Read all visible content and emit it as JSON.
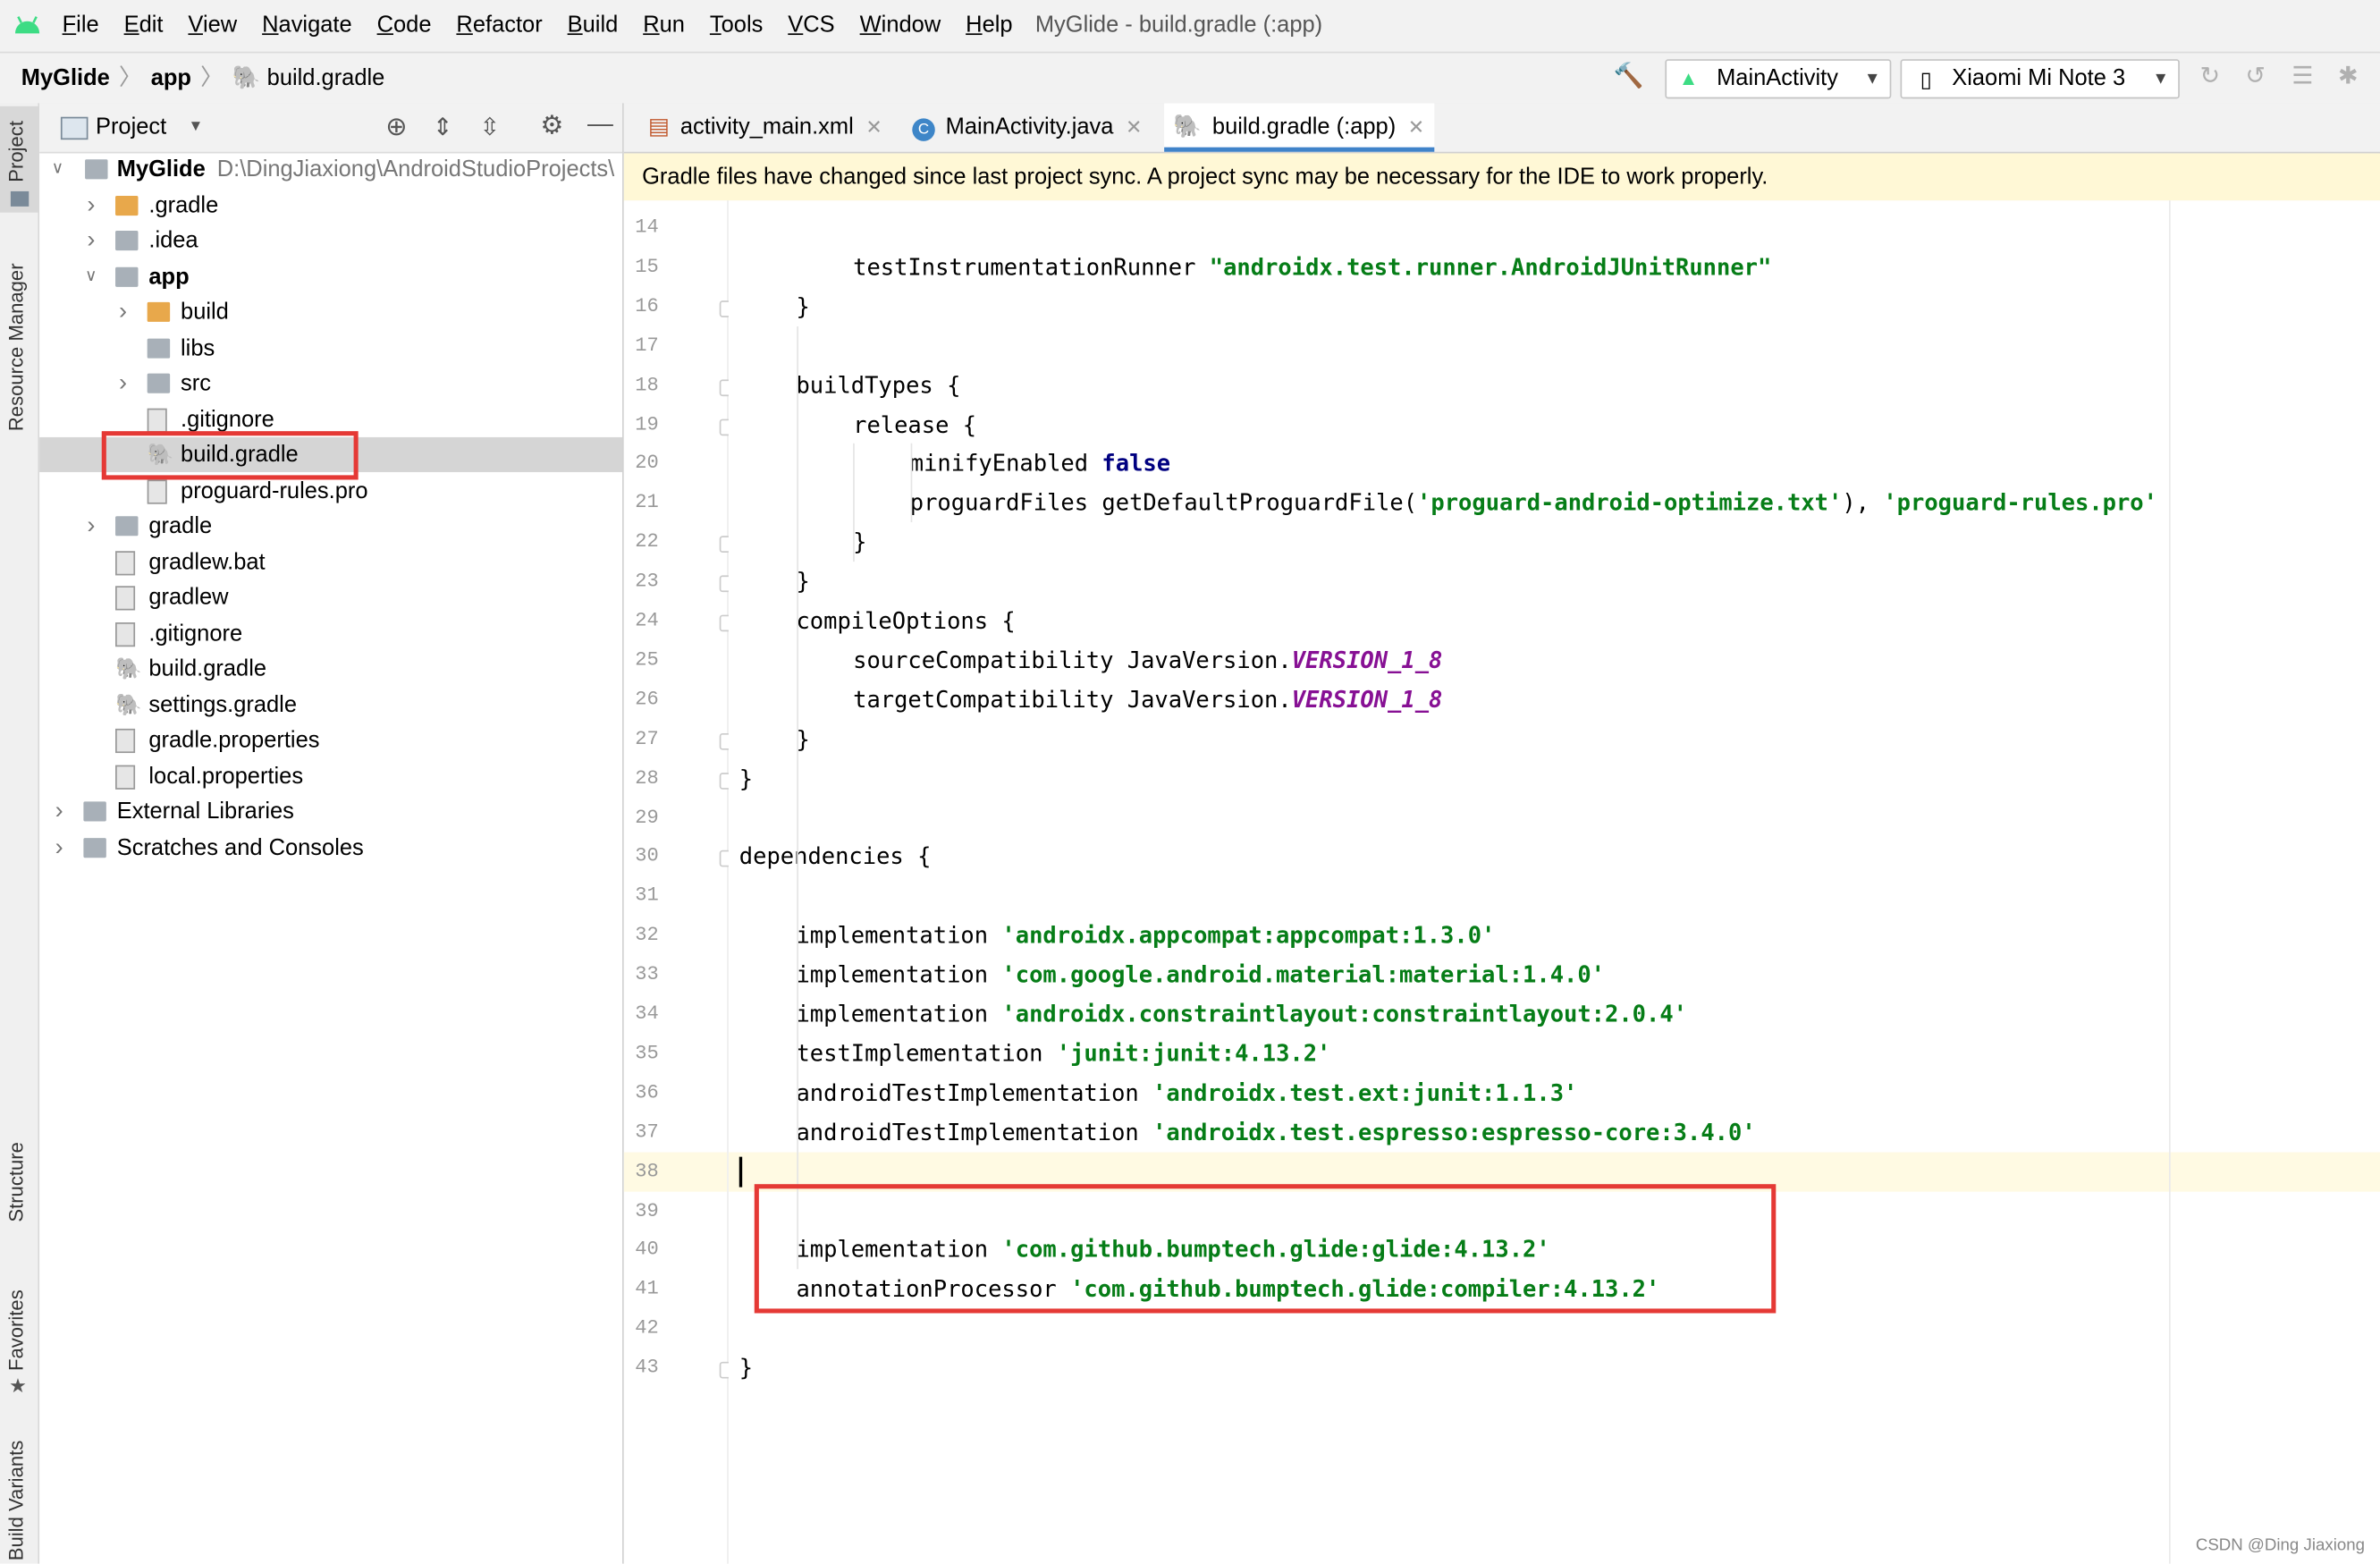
{
  "menubar": {
    "items": [
      "File",
      "Edit",
      "View",
      "Navigate",
      "Code",
      "Refactor",
      "Build",
      "Run",
      "Tools",
      "VCS",
      "Window",
      "Help"
    ],
    "window_title": "MyGlide - build.gradle (:app)"
  },
  "navbar": {
    "breadcrumb": [
      "MyGlide",
      "app",
      "build.gradle"
    ],
    "run_config": "MainActivity",
    "device": "Xiaomi Mi Note 3"
  },
  "left_strip": [
    "Project",
    "Resource Manager",
    "Structure",
    "Favorites",
    "Build Variants"
  ],
  "project_panel": {
    "title": "Project",
    "root_name": "MyGlide",
    "root_path": "D:\\DingJiaxiong\\AndroidStudioProjects\\",
    "tree": [
      {
        "label": ".gradle",
        "icon": "folder-orange-icon",
        "depth": 1,
        "arrow": "right"
      },
      {
        "label": ".idea",
        "icon": "folder-icon",
        "depth": 1,
        "arrow": "right"
      },
      {
        "label": "app",
        "icon": "module-folder-icon",
        "depth": 1,
        "arrow": "down",
        "bold": true
      },
      {
        "label": "build",
        "icon": "folder-orange-icon",
        "depth": 2,
        "arrow": "right"
      },
      {
        "label": "libs",
        "icon": "folder-icon",
        "depth": 2,
        "arrow": ""
      },
      {
        "label": "src",
        "icon": "folder-icon",
        "depth": 2,
        "arrow": "right"
      },
      {
        "label": ".gitignore",
        "icon": "gitignore-file-icon",
        "depth": 2,
        "arrow": ""
      },
      {
        "label": "build.gradle",
        "icon": "gradle-icon",
        "depth": 2,
        "arrow": "",
        "selected": true
      },
      {
        "label": "proguard-rules.pro",
        "icon": "text-file-icon",
        "depth": 2,
        "arrow": ""
      },
      {
        "label": "gradle",
        "icon": "folder-icon",
        "depth": 1,
        "arrow": "right"
      },
      {
        "label": "gradlew.bat",
        "icon": "text-file-icon",
        "depth": 1,
        "arrow": ""
      },
      {
        "label": "gradlew",
        "icon": "script-file-icon",
        "depth": 1,
        "arrow": ""
      },
      {
        "label": ".gitignore",
        "icon": "gitignore-file-icon",
        "depth": 1,
        "arrow": ""
      },
      {
        "label": "build.gradle",
        "icon": "gradle-icon",
        "depth": 1,
        "arrow": ""
      },
      {
        "label": "settings.gradle",
        "icon": "gradle-icon",
        "depth": 1,
        "arrow": ""
      },
      {
        "label": "gradle.properties",
        "icon": "properties-file-icon",
        "depth": 1,
        "arrow": ""
      },
      {
        "label": "local.properties",
        "icon": "properties-file-icon",
        "depth": 1,
        "arrow": ""
      },
      {
        "label": "External Libraries",
        "icon": "libraries-icon",
        "depth": 0,
        "arrow": "right"
      },
      {
        "label": "Scratches and Consoles",
        "icon": "scratches-icon",
        "depth": 0,
        "arrow": "right"
      }
    ]
  },
  "editor": {
    "tabs": [
      {
        "label": "activity_main.xml",
        "icon": "xml-file-icon",
        "active": false
      },
      {
        "label": "MainActivity.java",
        "icon": "java-class-icon",
        "active": false
      },
      {
        "label": "build.gradle (:app)",
        "icon": "gradle-icon",
        "active": true
      }
    ],
    "banner": "Gradle files have changed since last project sync. A project sync may be necessary for the IDE to work properly.",
    "current_line": 38,
    "lines": [
      {
        "n": 14,
        "indent": 0,
        "tokens": []
      },
      {
        "n": 15,
        "indent": 2,
        "tokens": [
          {
            "t": "testInstrumentationRunner ",
            "c": "plain"
          },
          {
            "t": "\"androidx.test.runner.AndroidJUnitRunner\"",
            "c": "str"
          }
        ]
      },
      {
        "n": 16,
        "indent": 1,
        "tokens": [
          {
            "t": "}",
            "c": "plain"
          }
        ]
      },
      {
        "n": 17,
        "indent": 0,
        "tokens": []
      },
      {
        "n": 18,
        "indent": 1,
        "tokens": [
          {
            "t": "buildTypes {",
            "c": "plain"
          }
        ]
      },
      {
        "n": 19,
        "indent": 2,
        "tokens": [
          {
            "t": "release {",
            "c": "plain"
          }
        ]
      },
      {
        "n": 20,
        "indent": 3,
        "tokens": [
          {
            "t": "minifyEnabled ",
            "c": "plain"
          },
          {
            "t": "false",
            "c": "kw"
          }
        ]
      },
      {
        "n": 21,
        "indent": 3,
        "tokens": [
          {
            "t": "proguardFiles getDefaultProguardFile(",
            "c": "plain"
          },
          {
            "t": "'proguard-android-optimize.txt'",
            "c": "str"
          },
          {
            "t": "), ",
            "c": "plain"
          },
          {
            "t": "'proguard-rules.pro'",
            "c": "str"
          }
        ]
      },
      {
        "n": 22,
        "indent": 2,
        "tokens": [
          {
            "t": "}",
            "c": "plain"
          }
        ]
      },
      {
        "n": 23,
        "indent": 1,
        "tokens": [
          {
            "t": "}",
            "c": "plain"
          }
        ]
      },
      {
        "n": 24,
        "indent": 1,
        "tokens": [
          {
            "t": "compileOptions {",
            "c": "plain"
          }
        ]
      },
      {
        "n": 25,
        "indent": 2,
        "tokens": [
          {
            "t": "sourceCompatibility JavaVersion.",
            "c": "plain"
          },
          {
            "t": "VERSION_1_8",
            "c": "const"
          }
        ]
      },
      {
        "n": 26,
        "indent": 2,
        "tokens": [
          {
            "t": "targetCompatibility JavaVersion.",
            "c": "plain"
          },
          {
            "t": "VERSION_1_8",
            "c": "const"
          }
        ]
      },
      {
        "n": 27,
        "indent": 1,
        "tokens": [
          {
            "t": "}",
            "c": "plain"
          }
        ]
      },
      {
        "n": 28,
        "indent": 0,
        "tokens": [
          {
            "t": "}",
            "c": "plain"
          }
        ]
      },
      {
        "n": 29,
        "indent": 0,
        "tokens": []
      },
      {
        "n": 30,
        "indent": 0,
        "tokens": [
          {
            "t": "dependencies {",
            "c": "plain"
          }
        ]
      },
      {
        "n": 31,
        "indent": 0,
        "tokens": []
      },
      {
        "n": 32,
        "indent": 1,
        "tokens": [
          {
            "t": "implementation ",
            "c": "plain"
          },
          {
            "t": "'androidx.appcompat:appcompat:1.3.0'",
            "c": "str"
          }
        ]
      },
      {
        "n": 33,
        "indent": 1,
        "tokens": [
          {
            "t": "implementation ",
            "c": "plain"
          },
          {
            "t": "'com.google.android.material:material:1.4.0'",
            "c": "str"
          }
        ]
      },
      {
        "n": 34,
        "indent": 1,
        "tokens": [
          {
            "t": "implementation ",
            "c": "plain"
          },
          {
            "t": "'androidx.constraintlayout:constraintlayout:2.0.4'",
            "c": "str"
          }
        ]
      },
      {
        "n": 35,
        "indent": 1,
        "tokens": [
          {
            "t": "testImplementation ",
            "c": "plain"
          },
          {
            "t": "'junit:junit:4.13.2'",
            "c": "str"
          }
        ]
      },
      {
        "n": 36,
        "indent": 1,
        "tokens": [
          {
            "t": "androidTestImplementation ",
            "c": "plain"
          },
          {
            "t": "'androidx.test.ext:junit:1.1.3'",
            "c": "str"
          }
        ]
      },
      {
        "n": 37,
        "indent": 1,
        "tokens": [
          {
            "t": "androidTestImplementation ",
            "c": "plain"
          },
          {
            "t": "'androidx.test.espresso:espresso-core:3.4.0'",
            "c": "str"
          }
        ]
      },
      {
        "n": 38,
        "indent": 0,
        "tokens": []
      },
      {
        "n": 39,
        "indent": 0,
        "tokens": []
      },
      {
        "n": 40,
        "indent": 1,
        "tokens": [
          {
            "t": "implementation ",
            "c": "plain"
          },
          {
            "t": "'com.github.bumptech.glide:glide:4.13.2'",
            "c": "str"
          }
        ]
      },
      {
        "n": 41,
        "indent": 1,
        "tokens": [
          {
            "t": "annotationProcessor ",
            "c": "plain"
          },
          {
            "t": "'com.github.bumptech.glide:compiler:4.13.2'",
            "c": "str"
          }
        ]
      },
      {
        "n": 42,
        "indent": 0,
        "tokens": []
      },
      {
        "n": 43,
        "indent": 0,
        "tokens": [
          {
            "t": "}",
            "c": "plain"
          }
        ]
      }
    ]
  },
  "watermark": "CSDN @Ding Jiaxiong",
  "colors": {
    "annotation_red": "#e53935",
    "string_green": "#067d17",
    "keyword_navy": "#000080",
    "constant_purple": "#871094",
    "banner_yellow": "#fff8d6",
    "current_line": "#fffae3",
    "selection_gray": "#d5d5d5"
  }
}
